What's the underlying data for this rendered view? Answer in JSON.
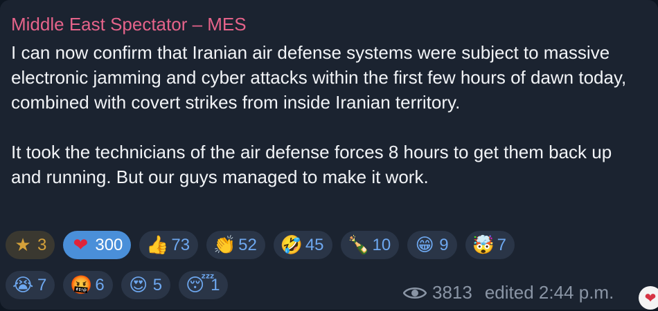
{
  "message": {
    "sender": "Middle East Spectator – MES",
    "paragraphs": [
      "I can now confirm that Iranian air defense systems were subject to massive electronic jamming and cyber attacks within the first few hours of dawn today, combined with covert strikes from inside Iranian territory.",
      "It took the technicians of the air defense forces 8 hours to get them back up and running. But our guys managed to make it work."
    ],
    "views": "3813",
    "edited_label": "edited 2:44 p.m.",
    "corner_reaction": "❤"
  },
  "reactions": [
    {
      "emoji": "★",
      "icon": "star-icon",
      "count": "3"
    },
    {
      "emoji": "❤",
      "icon": "red-heart-icon",
      "count": "300"
    },
    {
      "emoji": "👍",
      "icon": "thumbs-up-icon",
      "count": "73"
    },
    {
      "emoji": "👏",
      "icon": "clapping-hands-icon",
      "count": "52"
    },
    {
      "emoji": "🤣",
      "icon": "rolling-laughing-icon",
      "count": "45"
    },
    {
      "emoji": "🍾",
      "icon": "champagne-bottle-icon",
      "count": "10"
    },
    {
      "emoji": "😁",
      "icon": "grinning-face-icon",
      "count": "9"
    },
    {
      "emoji": "🤯",
      "icon": "exploding-head-icon",
      "count": "7"
    },
    {
      "emoji": "😭",
      "icon": "crying-face-icon",
      "count": "7"
    },
    {
      "emoji": "🤬",
      "icon": "cursing-face-icon",
      "count": "6"
    },
    {
      "emoji": "😍",
      "icon": "heart-eyes-icon",
      "count": "5"
    },
    {
      "emoji": "😴",
      "icon": "sleeping-face-icon",
      "count": "1"
    }
  ],
  "colors": {
    "sender": "#e5638a",
    "accent": "#4a8fd9",
    "bubble": "#1b2330"
  }
}
